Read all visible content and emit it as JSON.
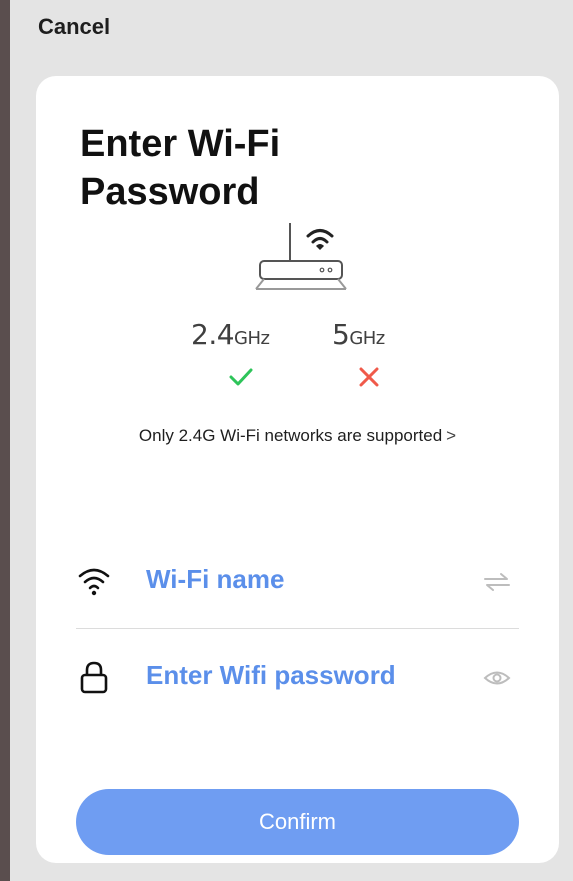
{
  "header": {
    "cancel_label": "Cancel"
  },
  "card": {
    "title_line1": "Enter Wi-Fi",
    "title_line2": "Password"
  },
  "frequencies": [
    {
      "num": "2.4",
      "unit": "GHz",
      "supported": true
    },
    {
      "num": "5",
      "unit": "GHz",
      "supported": false
    }
  ],
  "support_link": {
    "text": "Only 2.4G Wi-Fi networks are supported",
    "chevron": ">"
  },
  "wifi_name": {
    "placeholder": "Wi-Fi name",
    "lead_icon": "wifi-icon",
    "trail_icon": "swap-icon"
  },
  "wifi_password": {
    "placeholder": "Enter Wifi password",
    "lead_icon": "lock-icon",
    "trail_icon": "eye-icon"
  },
  "confirm_label": "Confirm",
  "colors": {
    "accent": "#6f9df2",
    "input_text": "#5b8fea",
    "ok": "#2ec45a",
    "error": "#f05a4a"
  }
}
